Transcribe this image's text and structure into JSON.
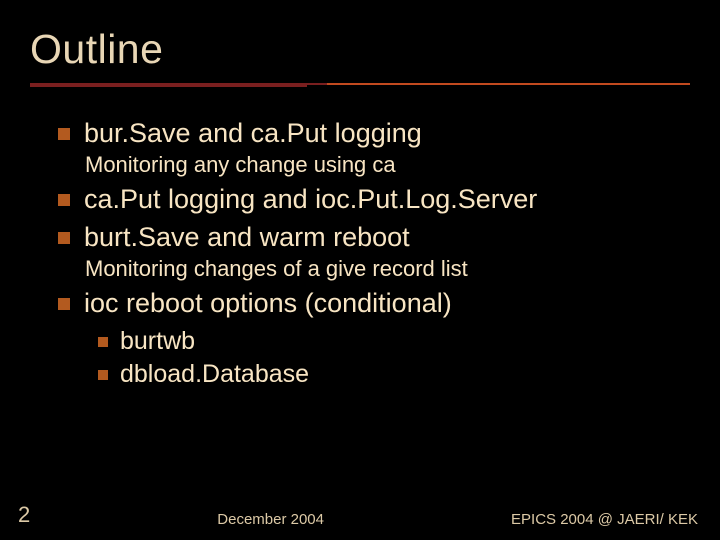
{
  "title": "Outline",
  "bullets": [
    {
      "text": "bur.Save and ca.Put logging",
      "sub": "Monitoring any change using ca"
    },
    {
      "text": "ca.Put logging and ioc.Put.Log.Server"
    },
    {
      "text": "burt.Save and warm reboot",
      "sub": "Monitoring changes of a give record list"
    },
    {
      "text": "ioc reboot options (conditional)",
      "children": [
        {
          "text": "burtwb"
        },
        {
          "text": "dbload.Database"
        }
      ]
    }
  ],
  "footer": {
    "page": "2",
    "center": "December 2004",
    "right": "EPICS 2004 @ JAERI/ KEK"
  }
}
